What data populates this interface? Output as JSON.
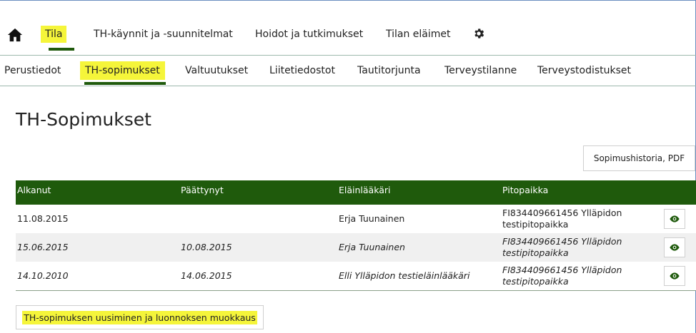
{
  "topnav": {
    "items": [
      {
        "label": "Tila"
      },
      {
        "label": "TH-käynnit ja -suunnitelmat"
      },
      {
        "label": "Hoidot ja tutkimukset"
      },
      {
        "label": "Tilan eläimet"
      }
    ]
  },
  "subnav": {
    "items": [
      {
        "label": "Perustiedot"
      },
      {
        "label": "TH-sopimukset"
      },
      {
        "label": "Valtuutukset"
      },
      {
        "label": "Liitetiedostot"
      },
      {
        "label": "Tautitorjunta"
      },
      {
        "label": "Terveystilanne"
      },
      {
        "label": "Terveystodistukset"
      }
    ]
  },
  "page": {
    "title": "TH-Sopimukset",
    "pdf_button": "Sopimushistoria, PDF",
    "renew_button": "TH-sopimuksen uusiminen ja luonnoksen muokkaus"
  },
  "table": {
    "headers": [
      "Alkanut",
      "Päättynyt",
      "Eläinlääkäri",
      "Pitopaikka"
    ],
    "rows": [
      {
        "start": "11.08.2015",
        "end": "",
        "vet": "Erja Tuunainen",
        "place": "FI834409661456 Ylläpidon testipitopaikka"
      },
      {
        "start": "15.06.2015",
        "end": "10.08.2015",
        "vet": "Erja Tuunainen",
        "place": "FI834409661456 Ylläpidon testipitopaikka"
      },
      {
        "start": "14.10.2010",
        "end": "14.06.2015",
        "vet": "Elli Ylläpidon testieläinlääkäri",
        "place": "FI834409661456 Ylläpidon testipitopaikka"
      }
    ]
  },
  "colors": {
    "accent": "#1f5a0c",
    "highlight": "#f5f53a"
  },
  "icons": {
    "home": "home-icon",
    "settings": "gear-icon",
    "view": "eye-icon"
  }
}
